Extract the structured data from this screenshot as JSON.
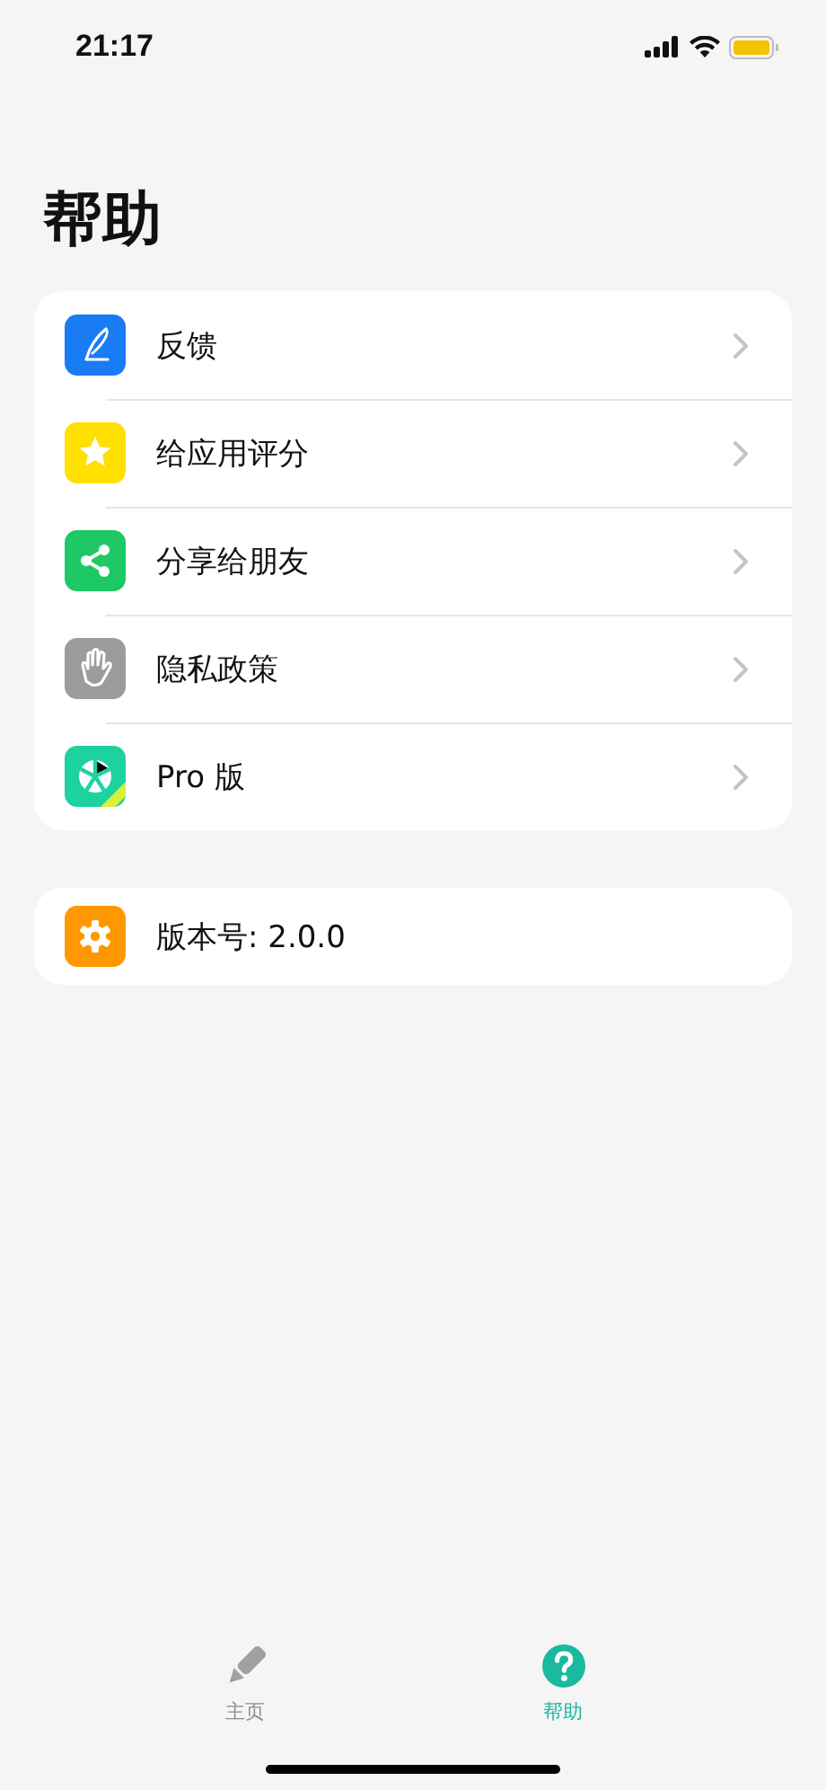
{
  "status_bar": {
    "time": "21:17"
  },
  "title": "帮助",
  "menu": [
    {
      "label": "反馈",
      "kind": "pen",
      "color": "#1a7cf5"
    },
    {
      "label": "给应用评分",
      "kind": "star",
      "color": "#ffe000"
    },
    {
      "label": "分享给朋友",
      "kind": "share",
      "color": "#1ec864"
    },
    {
      "label": "隐私政策",
      "kind": "hand",
      "color": "#9c9c9c"
    },
    {
      "label": "Pro 版",
      "kind": "pro",
      "color": "#1ed2a0"
    }
  ],
  "version": {
    "label": "版本号: 2.0.0",
    "kind": "gear",
    "color": "#ff9800"
  },
  "tabs": [
    {
      "label": "主页",
      "kind": "pencil",
      "selected": false
    },
    {
      "label": "帮助",
      "kind": "question",
      "selected": true
    }
  ]
}
